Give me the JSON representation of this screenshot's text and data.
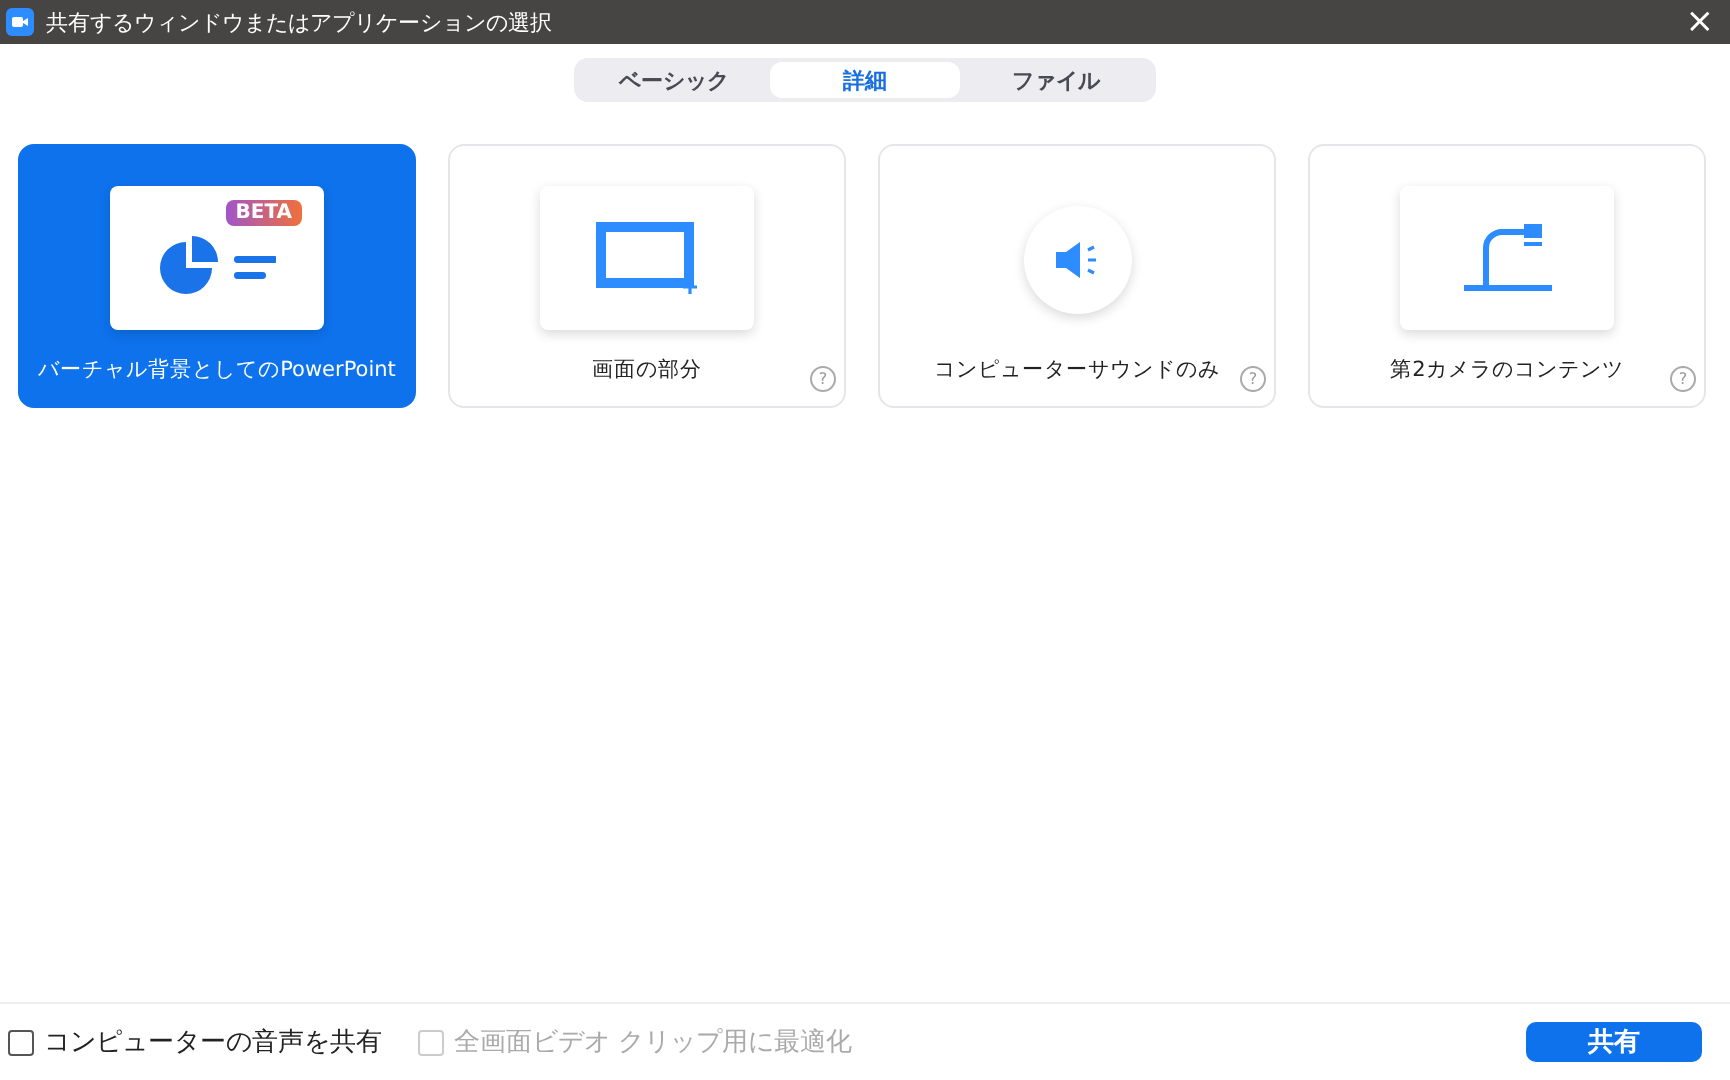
{
  "window": {
    "title": "共有するウィンドウまたはアプリケーションの選択",
    "close": "×"
  },
  "tabs": [
    {
      "label": "ベーシック",
      "selected": false
    },
    {
      "label": "詳細",
      "selected": true
    },
    {
      "label": "ファイル",
      "selected": false
    }
  ],
  "cards": [
    {
      "kind": "slide",
      "label": "バーチャル背景としてのPowerPoint",
      "badge": "BETA",
      "selected": true
    },
    {
      "kind": "region",
      "label": "画面の部分",
      "help": "?",
      "selected": false
    },
    {
      "kind": "sound",
      "label": "コンピューターサウンドのみ",
      "help": "?",
      "selected": false
    },
    {
      "kind": "camera",
      "label": "第2カメラのコンテンツ",
      "help": "?",
      "selected": false
    }
  ],
  "options": [
    {
      "label": "コンピューターの音声を共有",
      "checked": false,
      "disabled": false
    },
    {
      "label": "全画面ビデオ クリップ用に最適化",
      "checked": false,
      "disabled": true
    }
  ],
  "share_button": "共有"
}
